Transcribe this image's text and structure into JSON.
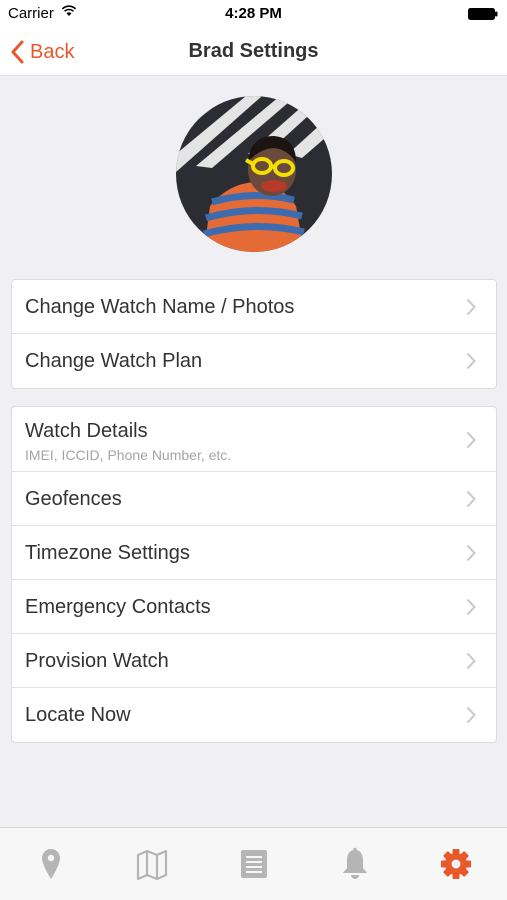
{
  "status_bar": {
    "carrier": "Carrier",
    "time": "4:28 PM"
  },
  "nav": {
    "back_label": "Back",
    "title": "Brad Settings"
  },
  "colors": {
    "accent": "#e8582a",
    "tab_inactive": "#b5b5b5",
    "background": "#efeff4"
  },
  "group1": [
    {
      "label": "Change Watch Name / Photos"
    },
    {
      "label": "Change Watch Plan"
    }
  ],
  "group2": [
    {
      "label": "Watch Details",
      "sublabel": "IMEI, ICCID, Phone Number, etc."
    },
    {
      "label": "Geofences"
    },
    {
      "label": "Timezone Settings"
    },
    {
      "label": "Emergency Contacts"
    },
    {
      "label": "Provision Watch"
    },
    {
      "label": "Locate Now"
    }
  ],
  "tabs": [
    {
      "icon": "location-pin-icon",
      "active": false
    },
    {
      "icon": "map-icon",
      "active": false
    },
    {
      "icon": "list-icon",
      "active": false
    },
    {
      "icon": "bell-icon",
      "active": false
    },
    {
      "icon": "gear-icon",
      "active": true
    }
  ]
}
